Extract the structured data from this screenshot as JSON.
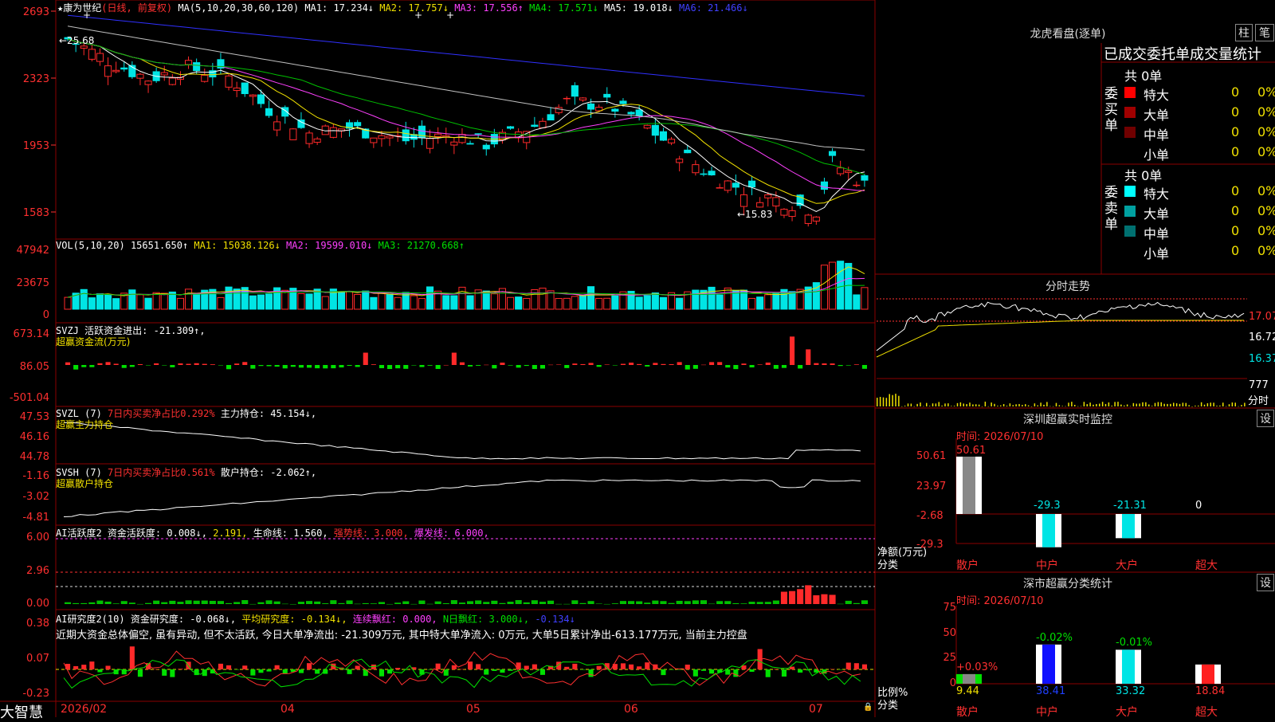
{
  "colors": {
    "up": "#ff2a2a",
    "down": "#00e5e5",
    "grid": "#8b0000",
    "ma1": "#ffffff",
    "ma2": "#f0e000",
    "ma3": "#ff40ff",
    "ma4": "#00c000",
    "ma5": "#c0c0c0",
    "ma6": "#3030ff"
  },
  "header": {
    "stock": "★康为世纪",
    "period": "(日线, 前复权)",
    "ma_params": "MA(5,10,20,30,60,120)",
    "ma1": "MA1: 17.234↓",
    "ma2": "MA2: 17.757↓",
    "ma3": "MA3: 17.556↑",
    "ma4": "MA4: 17.571↓",
    "ma5": "MA5: 19.018↓",
    "ma6": "MA6: 21.466↓"
  },
  "price_panel": {
    "axis": [
      "2693",
      "2323",
      "1953",
      "1583"
    ],
    "high_label": "←25.68",
    "low_label": "←15.83"
  },
  "vol_panel": {
    "title": "VOL(5,10,20)",
    "vol": "15651.650↑",
    "ma1": "MA1: 15038.126↓",
    "ma2": "MA2: 19599.010↓",
    "ma3": "MA3: 21270.668↑",
    "axis": [
      "47942",
      "23675",
      "0"
    ]
  },
  "svzj_panel": {
    "title": "SVZJ",
    "active": "活跃资金进出: -21.309↑,",
    "sub": "超赢资金流(万元)",
    "axis": [
      "673.14",
      "86.05",
      "-501.04"
    ]
  },
  "svzl_panel": {
    "title": "SVZL (7)",
    "ratio": "7日内买卖净占比0.292%",
    "hold": "主力持仓: 45.154↓,",
    "sub": "超赢主力持仓",
    "axis": [
      "47.53",
      "46.16",
      "44.78"
    ]
  },
  "svsh_panel": {
    "title": "SVSH (7)",
    "ratio": "7日内买卖净占比0.561%",
    "hold": "散户持仓: -2.062↑,",
    "sub": "超赢散户持仓",
    "axis": [
      "-1.16",
      "-3.02",
      "-4.81"
    ]
  },
  "ai_active": {
    "title": "AI活跃度2",
    "fund": "资金活跃度: 0.008↓,",
    "v2": "2.191,",
    "life": "生命线: 1.560,",
    "strong": "强势线: 3.000,",
    "burst": "爆发线: 6.000,",
    "axis": [
      "6.00",
      "2.96",
      "0.00"
    ]
  },
  "ai_research": {
    "title": "AI研究度2(10)",
    "fund": "资金研究度: -0.068↓,",
    "avg": "平均研究度: -0.134↓,",
    "red": "连续飘红: 0.000,",
    "nred": "N日飘红: 3.000↓,",
    "v": "-0.134↓",
    "comment": "近期大资金总体偏空, 虽有异动, 但不太活跃, 今日大单净流出: -21.309万元, 其中特大单净流入: 0万元, 大单5日累计净出-613.177万元, 当前主力控盘",
    "axis": [
      "0.38",
      "0.07",
      "-0.23"
    ]
  },
  "footer": {
    "brand": "大智慧",
    "dates": [
      "2026/02",
      "04",
      "05",
      "06",
      "07"
    ]
  },
  "dragon": {
    "title": "龙虎看盘(逐单)",
    "btn1": "柱",
    "btn2": "笔",
    "header": "已成交委托单成交量统计",
    "buy": {
      "label": "委买单",
      "total": "共 0单",
      "rows": [
        {
          "name": "特大",
          "v": "0",
          "p": "0%",
          "c": "#ff0000"
        },
        {
          "name": "大单",
          "v": "0",
          "p": "0%",
          "c": "#a00000"
        },
        {
          "name": "中单",
          "v": "0",
          "p": "0%",
          "c": "#700000"
        },
        {
          "name": "小单",
          "v": "0",
          "p": "0%",
          "c": "#000000"
        }
      ]
    },
    "sell": {
      "label": "委卖单",
      "total": "共 0单",
      "rows": [
        {
          "name": "特大",
          "v": "0",
          "p": "0%",
          "c": "#00ffff"
        },
        {
          "name": "大单",
          "v": "0",
          "p": "0%",
          "c": "#00a0a0"
        },
        {
          "name": "中单",
          "v": "0",
          "p": "0%",
          "c": "#007070"
        },
        {
          "name": "小单",
          "v": "0",
          "p": "0%",
          "c": "#000000"
        }
      ]
    }
  },
  "intraday": {
    "title": "分时走势",
    "axis": [
      "17.07",
      "16.72",
      "16.37",
      "777",
      "分时"
    ]
  },
  "sz_monitor": {
    "title": "深圳超赢实时监控",
    "btn": "设",
    "time": "时间: 2026/07/10",
    "axis": [
      "50.61",
      "23.97",
      "-2.68",
      "-29.3"
    ],
    "ylabel": "净额(万元)",
    "xlabel": "分类",
    "bars": [
      {
        "cat": "散户",
        "value": 50.61,
        "label": "50.61"
      },
      {
        "cat": "中户",
        "value": -29.3,
        "label": "-29.3"
      },
      {
        "cat": "大户",
        "value": -21.31,
        "label": "-21.31"
      },
      {
        "cat": "超大",
        "value": 0,
        "label": "0"
      }
    ]
  },
  "sz_class": {
    "title": "深市超赢分类统计",
    "btn": "设",
    "time": "时间: 2026/07/10",
    "axis": [
      "75",
      "50",
      "25",
      "0"
    ],
    "ylabel": "比例%",
    "xlabel": "分类",
    "bars": [
      {
        "cat": "散户",
        "value": 9.44,
        "label": "9.44",
        "chg": "+0.03%"
      },
      {
        "cat": "中户",
        "value": 38.41,
        "label": "38.41",
        "chg": "-0.02%"
      },
      {
        "cat": "大户",
        "value": 33.32,
        "label": "33.32",
        "chg": "-0.01%"
      },
      {
        "cat": "超大",
        "value": 18.84,
        "label": "18.84",
        "chg": ""
      }
    ]
  }
}
